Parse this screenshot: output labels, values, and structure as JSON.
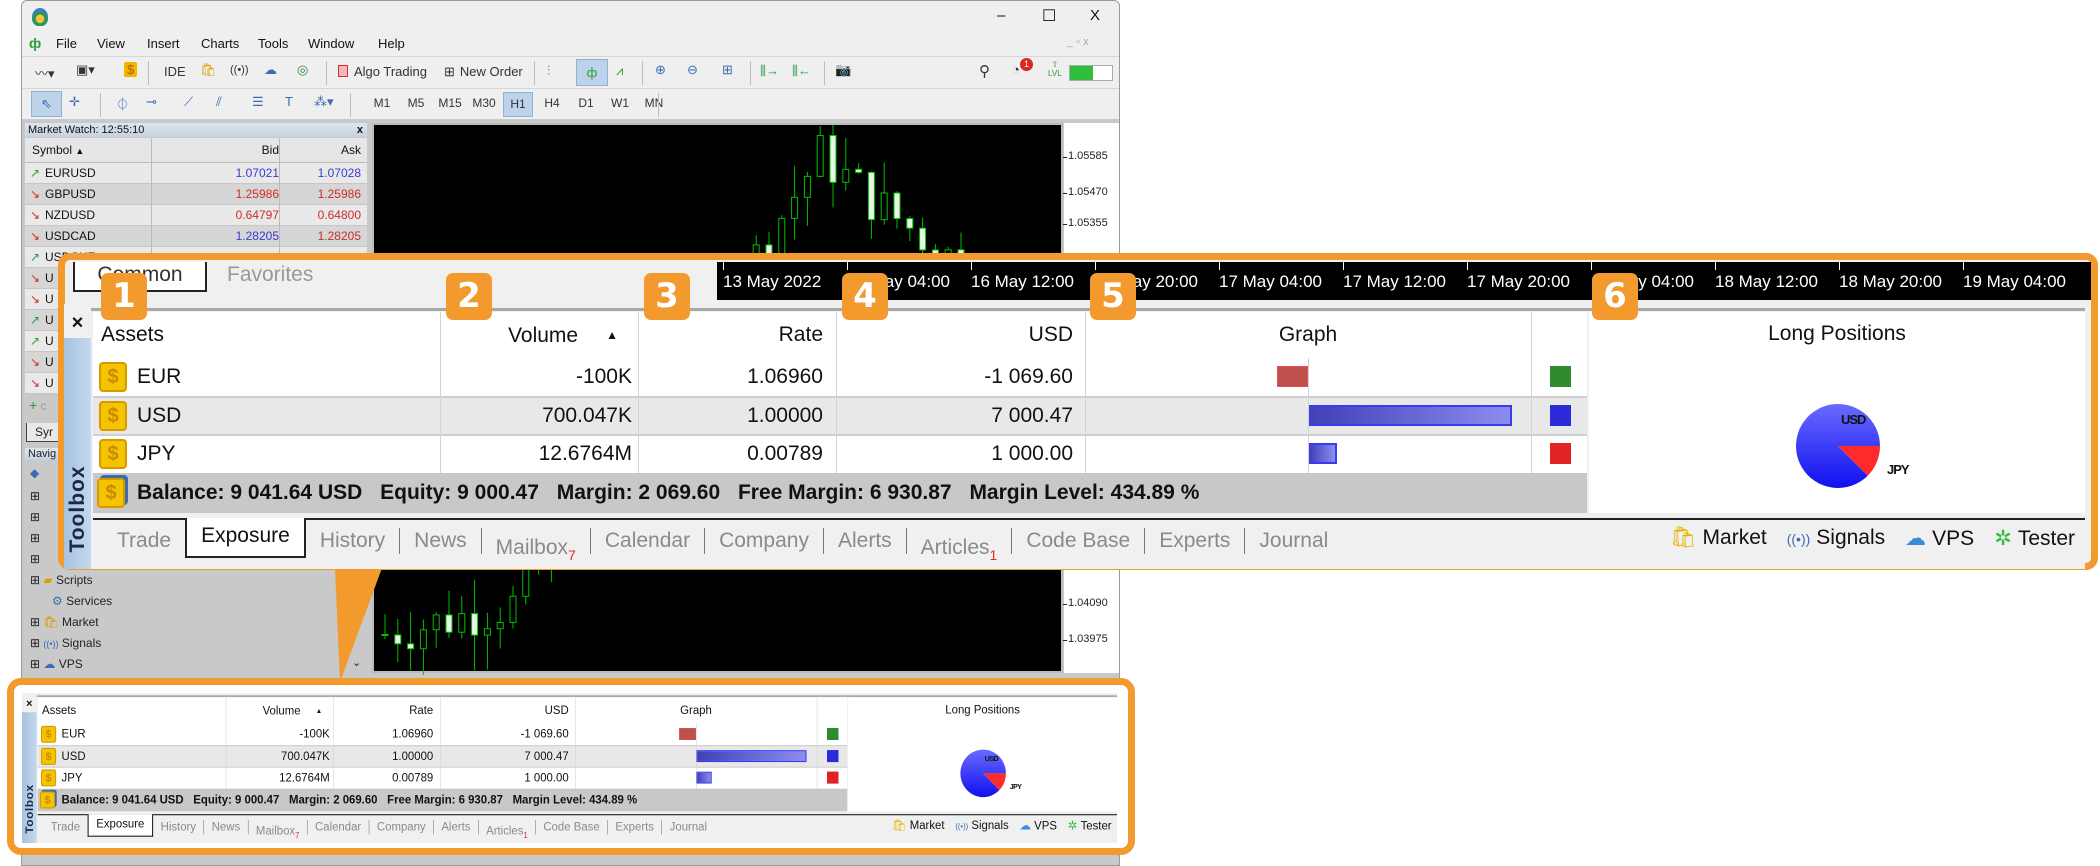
{
  "window": {
    "menu": [
      "File",
      "View",
      "Insert",
      "Charts",
      "Tools",
      "Window",
      "Help"
    ],
    "controls": {
      "minimize": "–",
      "maximize": "☐",
      "close": "X"
    }
  },
  "toolbar": {
    "ide_label": "IDE",
    "algo_trading_label": "Algo Trading",
    "new_order_label": "New Order",
    "notification_count": "1",
    "lvl_label": "LVL"
  },
  "timeframes": [
    "M1",
    "M5",
    "M15",
    "M30",
    "H1",
    "H4",
    "D1",
    "W1",
    "MN"
  ],
  "selected_timeframe": "H1",
  "market_watch": {
    "title": "Market Watch: 12:55:10",
    "columns": [
      "Symbol",
      "Bid",
      "Ask"
    ],
    "rows": [
      {
        "symbol": "EURUSD",
        "bid": "1.07021",
        "ask": "1.07028",
        "dir": "up",
        "bid_color": "#3a3ad0",
        "ask_color": "#3a3ad0"
      },
      {
        "symbol": "GBPUSD",
        "bid": "1.25986",
        "ask": "1.25986",
        "dir": "down",
        "bid_color": "#d02a2a",
        "ask_color": "#d02a2a"
      },
      {
        "symbol": "NZDUSD",
        "bid": "0.64797",
        "ask": "0.64800",
        "dir": "down",
        "bid_color": "#d02a2a",
        "ask_color": "#d02a2a"
      },
      {
        "symbol": "USDCAD",
        "bid": "1.28205",
        "ask": "1.28205",
        "dir": "down",
        "bid_color": "#3a3ad0",
        "ask_color": "#d02a2a"
      },
      {
        "symbol": "USDCHF",
        "dir": "up"
      },
      {
        "symbol": "U",
        "dir": "down"
      },
      {
        "symbol": "U",
        "dir": "down"
      },
      {
        "symbol": "U",
        "dir": "up"
      },
      {
        "symbol": "U",
        "dir": "up"
      },
      {
        "symbol": "U",
        "dir": "down"
      },
      {
        "symbol": "U",
        "dir": "down"
      }
    ],
    "add_label": "c",
    "tab_label": "Syr"
  },
  "navigator": {
    "title": "Navig",
    "items": [
      "Scripts",
      "Services",
      "Market",
      "Signals",
      "VPS"
    ]
  },
  "chart": {
    "price_labels": [
      "1.05585",
      "1.05470",
      "1.05355",
      "1.04090",
      "1.03975"
    ],
    "time_labels": [
      "13 May 2022",
      "16 May 04:00",
      "16 May 12:00",
      "16 May 20:00",
      "17 May 04:00",
      "17 May 12:00",
      "17 May 20:00",
      "18 May 04:00",
      "18 May 12:00",
      "18 May 20:00",
      "19 May 04:00"
    ]
  },
  "toolbox": {
    "title": "Toolbox",
    "top_tabs": [
      "Common",
      "Favorites"
    ],
    "columns": {
      "assets": "Assets",
      "volume": "Volume",
      "rate": "Rate",
      "usd": "USD",
      "graph": "Graph"
    },
    "rows": [
      {
        "asset": "EUR",
        "volume": "-100K",
        "rate": "1.06960",
        "usd": "-1 069.60",
        "color": "#2e8b2e"
      },
      {
        "asset": "USD",
        "volume": "700.047K",
        "rate": "1.00000",
        "usd": "7 000.47",
        "color": "#2b2bd9"
      },
      {
        "asset": "JPY",
        "volume": "12.6764M",
        "rate": "0.00789",
        "usd": "1 000.00",
        "color": "#e02424"
      }
    ],
    "balance": {
      "balance": "Balance: 9 041.64 USD",
      "equity": "Equity: 9 000.47",
      "margin": "Margin: 2 069.60",
      "free_margin": "Free Margin: 6 930.87",
      "margin_level": "Margin Level: 434.89 %"
    },
    "long_positions": {
      "title": "Long Positions",
      "labels": [
        "USD",
        "JPY"
      ]
    },
    "tabs": [
      {
        "label": "Trade"
      },
      {
        "label": "Exposure",
        "active": true
      },
      {
        "label": "History"
      },
      {
        "label": "News"
      },
      {
        "label": "Mailbox",
        "badge": "7"
      },
      {
        "label": "Calendar"
      },
      {
        "label": "Company"
      },
      {
        "label": "Alerts"
      },
      {
        "label": "Articles",
        "badge": "1"
      },
      {
        "label": "Code Base"
      },
      {
        "label": "Experts"
      },
      {
        "label": "Journal"
      }
    ],
    "links": [
      "Market",
      "Signals",
      "VPS",
      "Tester"
    ]
  },
  "callouts": [
    "1",
    "2",
    "3",
    "4",
    "5",
    "6"
  ],
  "colors": {
    "accent": "#f29a2e",
    "negative_bar": "#c0504d",
    "positive_bar": "#4a4ad0",
    "chart_bg": "#000000",
    "candle": "#00c000"
  }
}
